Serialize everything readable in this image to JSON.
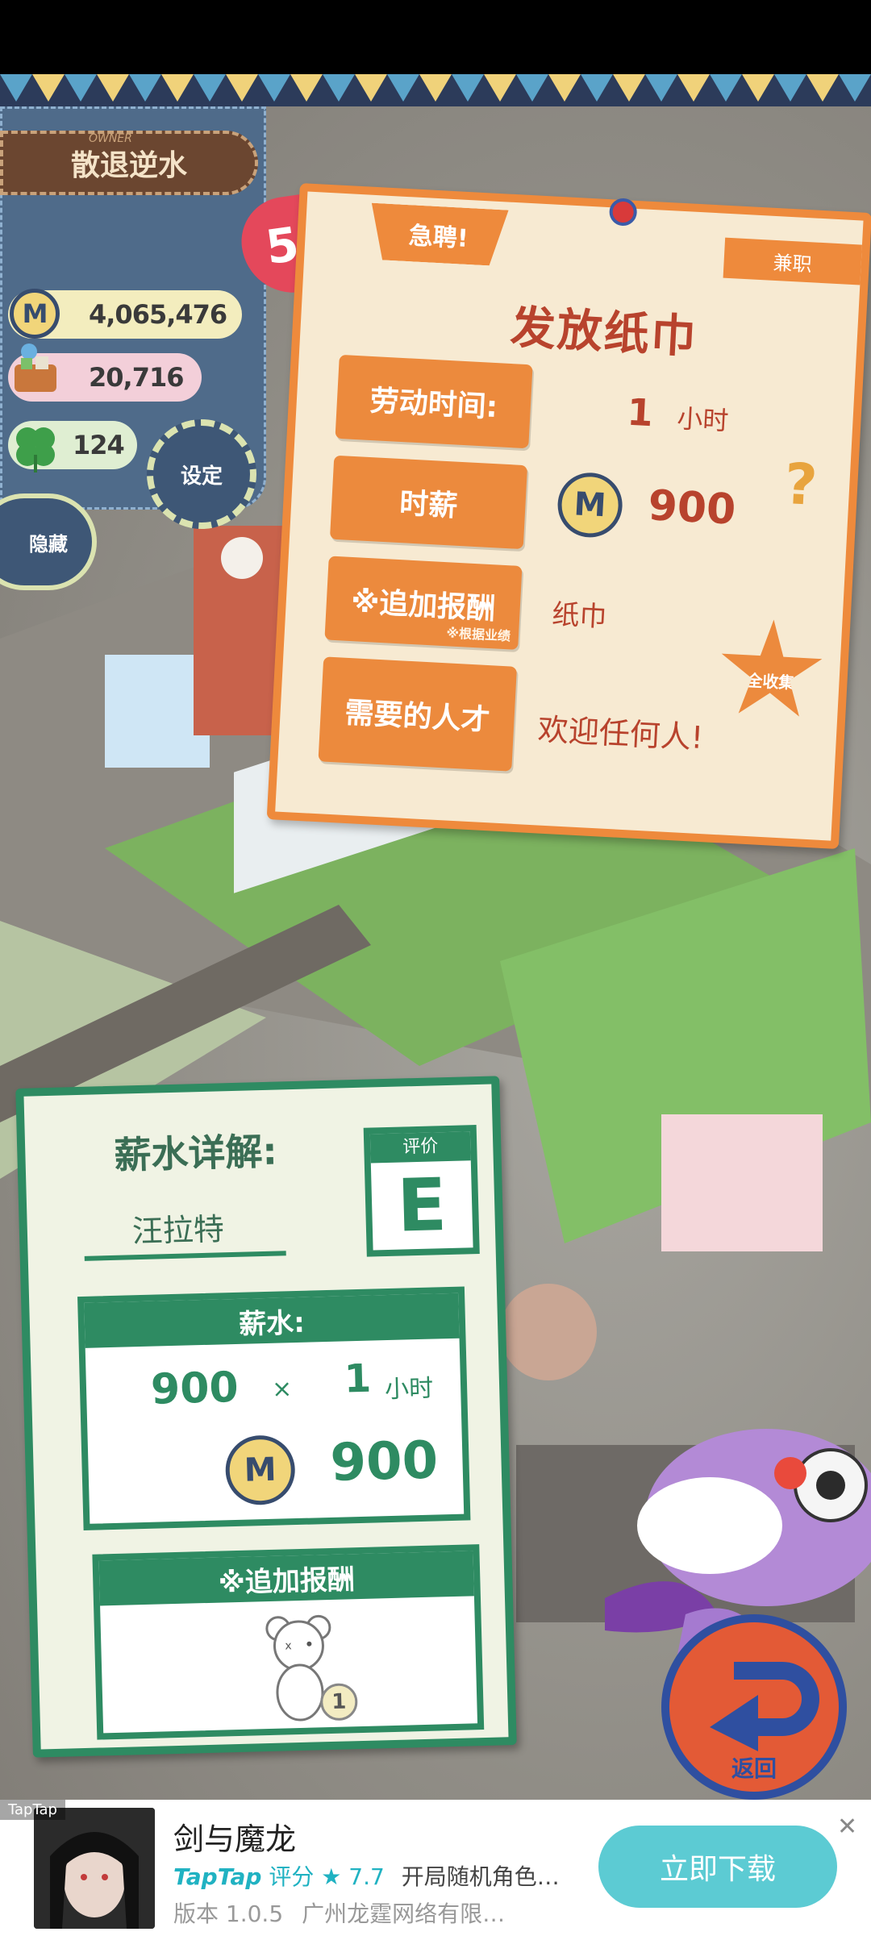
{
  "player": {
    "owner_tag": "OWNER",
    "name": "散退逆水",
    "level": "53",
    "coins": "4,065,476",
    "stock": "20,716",
    "clover": "124",
    "settings_label": "设定",
    "hide_label": "隐藏",
    "coin_symbol": "M"
  },
  "job": {
    "urgent_label": "急聘!",
    "part_time_label": "兼职",
    "title": "发放纸巾",
    "work_time_label": "劳动时间:",
    "work_time_value": "1",
    "work_time_unit": "小时",
    "hourly_wage_label": "时薪",
    "hourly_wage_value": "900",
    "extra_reward_label": "※追加报酬",
    "extra_reward_note": "※根据业绩",
    "extra_reward_value": "纸巾",
    "talent_label": "需要的人才",
    "talent_value": "欢迎任何人!",
    "help": "?",
    "collection_badge": "全收集"
  },
  "salary": {
    "title": "薪水详解:",
    "rating_label": "评价",
    "rating_grade": "E",
    "worker_name": "汪拉特",
    "pay_label": "薪水:",
    "rate": "900",
    "times": "×",
    "hours": "1",
    "hours_unit": "小时",
    "total": "900",
    "bonus_label": "※追加报酬",
    "bonus_count": "1"
  },
  "controls": {
    "return_label": "返回"
  },
  "ad": {
    "tag": "TapTap",
    "title": "剑与魔龙",
    "brand": "TapTap",
    "rating_label": "评分",
    "rating_value": "★ 7.7",
    "desc": "开局随机角色…",
    "version": "版本 1.0.5",
    "publisher": "广州龙霆网络有限…",
    "download_label": "立即下载",
    "close": "✕"
  },
  "colors": {
    "accent_orange": "#ec8a3d",
    "accent_green": "#2e8b62",
    "button_teal": "#5ccbd3"
  }
}
